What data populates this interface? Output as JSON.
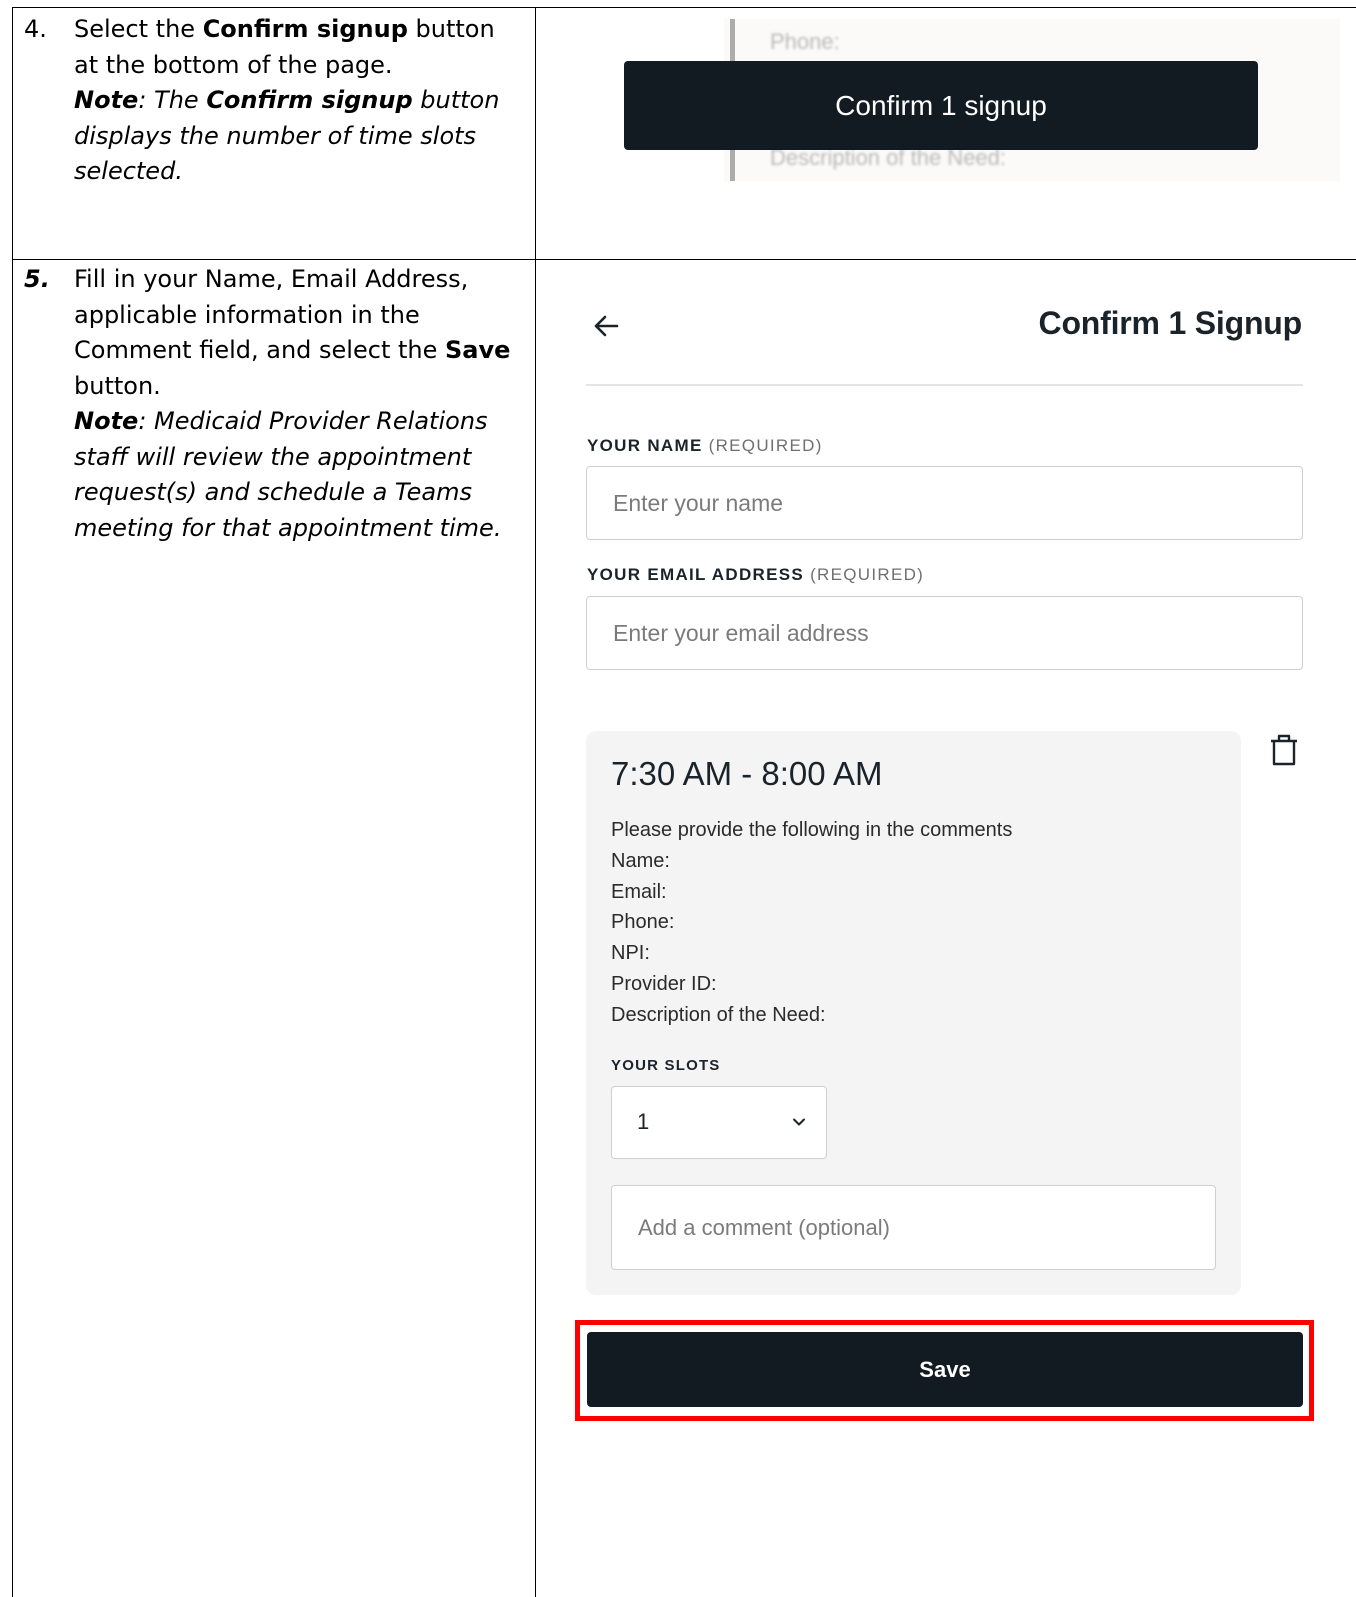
{
  "steps": [
    {
      "number": "4.",
      "line1_pre": "Select the ",
      "line1_bold": "Confirm signup",
      "line1_post": " button at the bottom of the page.",
      "note_label": "Note",
      "note_pre": ": The ",
      "note_bold": "Confirm signup",
      "note_post": " button displays the number of time slots selected."
    },
    {
      "number": "5.",
      "text_pre": "Fill in your Name, Email Address, applicable information in the Comment field, and select the ",
      "text_bold": "Save",
      "text_post": " button.",
      "note_label": "Note",
      "note_text": ": Medicaid Provider Relations staff will review the appointment request(s) and schedule a Teams meeting for that appointment time."
    }
  ],
  "screenshot_step4": {
    "ghost_top": "Phone:",
    "ghost_bottom": "Description of the Need:",
    "confirm_button_label": "Confirm 1 signup"
  },
  "form": {
    "title": "Confirm 1 Signup",
    "name_label": "YOUR NAME",
    "email_label": "YOUR EMAIL ADDRESS",
    "required_text": "(REQUIRED)",
    "name_placeholder": "Enter your name",
    "email_placeholder": "Enter your email address",
    "slot": {
      "time": "7:30 AM - 8:00 AM",
      "description_lines": [
        "Please provide the following in the comments",
        "Name:",
        "Email:",
        "Phone:",
        "NPI:",
        "Provider ID:",
        "Description of the Need:"
      ],
      "slots_label": "YOUR SLOTS",
      "slots_value": "1",
      "comment_placeholder": "Add a comment (optional)"
    },
    "save_label": "Save"
  },
  "colors": {
    "button_dark": "#121b22",
    "highlight_red": "#ff0000",
    "card_bg": "#f4f4f5"
  }
}
